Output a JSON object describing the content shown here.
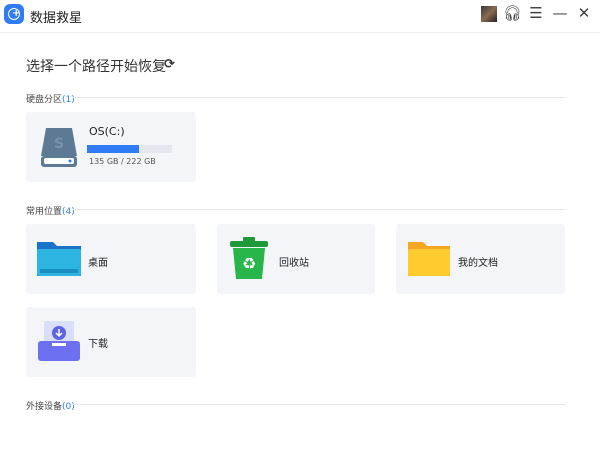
{
  "app": {
    "title": "数据救星"
  },
  "header": {
    "heading": "选择一个路径开始恢复"
  },
  "sections": {
    "disk": {
      "label": "硬盘分区",
      "count": "(1)"
    },
    "common": {
      "label": "常用位置",
      "count": "(4)"
    },
    "external": {
      "label": "外接设备",
      "count": "(0)"
    }
  },
  "drive": {
    "name": "OS(C:)",
    "usage": "135 GB / 222 GB",
    "used_fraction": 0.61
  },
  "locations": [
    {
      "label": "桌面"
    },
    {
      "label": "回收站"
    },
    {
      "label": "我的文档"
    },
    {
      "label": "下载"
    }
  ],
  "colors": {
    "accent": "#2f7cf6",
    "card": "#f4f5f9"
  }
}
